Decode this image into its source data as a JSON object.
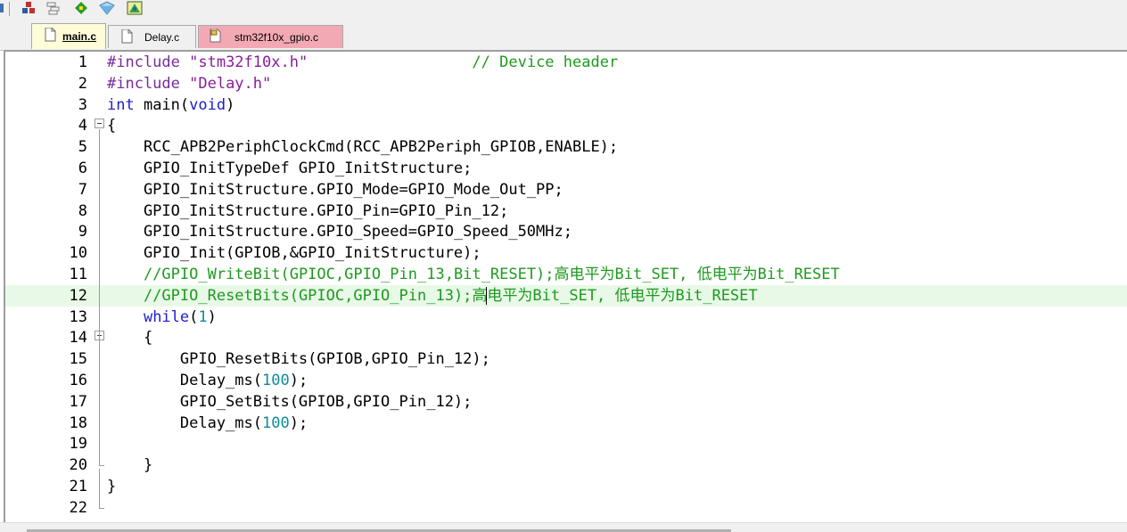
{
  "toolbar": {
    "icons": [
      "partial-icon-left",
      "insert-icon",
      "manage-icon",
      "pack-installer-icon",
      "options-icon",
      "components-icon"
    ]
  },
  "tabs": [
    {
      "label": "main.c",
      "active": true,
      "icon": "document-icon"
    },
    {
      "label": "Delay.c",
      "active": false,
      "icon": "document-icon"
    },
    {
      "label": "stm32f10x_gpio.c",
      "active": false,
      "icon": "document-lock-icon"
    }
  ],
  "editor": {
    "current_line": 12,
    "lines": [
      {
        "n": "1",
        "tokens": [
          {
            "t": "#include ",
            "c": "pp"
          },
          {
            "t": "\"stm32f10x.h\"",
            "c": "str"
          },
          {
            "t": "                  ",
            "c": ""
          },
          {
            "t": "// Device header",
            "c": "cm"
          }
        ]
      },
      {
        "n": "2",
        "tokens": [
          {
            "t": "#include ",
            "c": "pp"
          },
          {
            "t": "\"Delay.h\"",
            "c": "str"
          }
        ]
      },
      {
        "n": "3",
        "tokens": [
          {
            "t": "int",
            "c": "kw"
          },
          {
            "t": " main(",
            "c": ""
          },
          {
            "t": "void",
            "c": "kw"
          },
          {
            "t": ")",
            "c": ""
          }
        ]
      },
      {
        "n": "4",
        "fold": "open",
        "tokens": [
          {
            "t": "{",
            "c": ""
          }
        ]
      },
      {
        "n": "5",
        "tokens": [
          {
            "t": "    RCC_APB2PeriphClockCmd(RCC_APB2Periph_GPIOB,ENABLE);",
            "c": ""
          }
        ]
      },
      {
        "n": "6",
        "tokens": [
          {
            "t": "    GPIO_InitTypeDef GPIO_InitStructure;",
            "c": ""
          }
        ]
      },
      {
        "n": "7",
        "tokens": [
          {
            "t": "    GPIO_InitStructure.GPIO_Mode=GPIO_Mode_Out_PP;",
            "c": ""
          }
        ]
      },
      {
        "n": "8",
        "tokens": [
          {
            "t": "    GPIO_InitStructure.GPIO_Pin=GPIO_Pin_12;",
            "c": ""
          }
        ]
      },
      {
        "n": "9",
        "tokens": [
          {
            "t": "    GPIO_InitStructure.GPIO_Speed=GPIO_Speed_50MHz;",
            "c": ""
          }
        ]
      },
      {
        "n": "10",
        "tokens": [
          {
            "t": "    GPIO_Init(GPIOB,&GPIO_InitStructure);",
            "c": ""
          }
        ]
      },
      {
        "n": "11",
        "tokens": [
          {
            "t": "    ",
            "c": ""
          },
          {
            "t": "//GPIO_WriteBit(GPIOC,GPIO_Pin_13,Bit_RESET);高电平为Bit_SET, 低电平为Bit_RESET",
            "c": "cm"
          }
        ]
      },
      {
        "n": "12",
        "highlight": true,
        "tokens": [
          {
            "t": "    ",
            "c": ""
          },
          {
            "t": "//GPIO_ResetBits(GPIOC,GPIO_Pin_13);高电平为Bit_SET, 低电平为Bit_RESET",
            "c": "cm"
          }
        ]
      },
      {
        "n": "13",
        "tokens": [
          {
            "t": "    ",
            "c": ""
          },
          {
            "t": "while",
            "c": "kw"
          },
          {
            "t": "(",
            "c": ""
          },
          {
            "t": "1",
            "c": "nm"
          },
          {
            "t": ")",
            "c": ""
          }
        ]
      },
      {
        "n": "14",
        "fold": "open",
        "tokens": [
          {
            "t": "    {",
            "c": ""
          }
        ]
      },
      {
        "n": "15",
        "tokens": [
          {
            "t": "        GPIO_ResetBits(GPIOB,GPIO_Pin_12);",
            "c": ""
          }
        ]
      },
      {
        "n": "16",
        "tokens": [
          {
            "t": "        Delay_ms(",
            "c": ""
          },
          {
            "t": "100",
            "c": "nm"
          },
          {
            "t": ");",
            "c": ""
          }
        ]
      },
      {
        "n": "17",
        "tokens": [
          {
            "t": "        GPIO_SetBits(GPIOB,GPIO_Pin_12);",
            "c": ""
          }
        ]
      },
      {
        "n": "18",
        "tokens": [
          {
            "t": "        Delay_ms(",
            "c": ""
          },
          {
            "t": "100",
            "c": "nm"
          },
          {
            "t": ");",
            "c": ""
          }
        ]
      },
      {
        "n": "19",
        "tokens": []
      },
      {
        "n": "20",
        "fold": "end",
        "tokens": [
          {
            "t": "    }",
            "c": ""
          }
        ]
      },
      {
        "n": "21",
        "tokens": [
          {
            "t": "}",
            "c": ""
          }
        ]
      },
      {
        "n": "22",
        "fold": "end",
        "tokens": []
      }
    ]
  },
  "colors": {
    "keyword": "#1c1cd6",
    "preprocessor": "#7a2c9a",
    "string": "#8a1c9a",
    "comment": "#1e9a1e",
    "number": "#0d8a99",
    "current_line_bg": "#e8f9e8",
    "active_tab_bg": "#fffcd8",
    "inactive_tab_bg": "#f0f0f0",
    "pinned_tab_bg": "#f3a9b4"
  }
}
